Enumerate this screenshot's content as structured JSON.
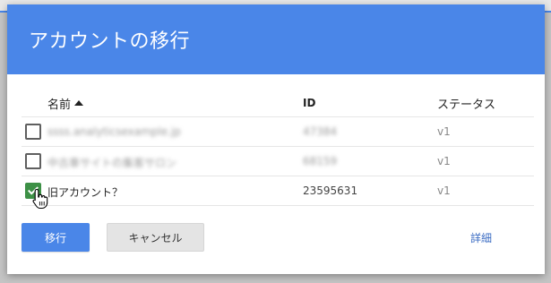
{
  "dialog": {
    "title": "アカウントの移行"
  },
  "table": {
    "columns": {
      "name": "名前",
      "id": "ID",
      "status": "ステータス"
    },
    "sort": "name-ascending",
    "rows": [
      {
        "checked": false,
        "name": "ssss.analyticsexample.jp",
        "id": "47384",
        "status": "v1",
        "blurred": true
      },
      {
        "checked": false,
        "name": "中古車サイトの集客サロン",
        "id": "68159",
        "status": "v1",
        "blurred": true
      },
      {
        "checked": true,
        "name": "旧アカウント？",
        "id": "23595631",
        "status": "v1",
        "blurred": false
      }
    ]
  },
  "buttons": {
    "migrate": "移行",
    "cancel": "キャンセル",
    "details": "詳細"
  },
  "colors": {
    "header": "#4a86e8",
    "checkbox_checked": "#3d9046",
    "link": "#3b6cc3"
  },
  "icons": {
    "cursor": "hand-pointer-icon",
    "sort": "sort-ascending-icon"
  }
}
